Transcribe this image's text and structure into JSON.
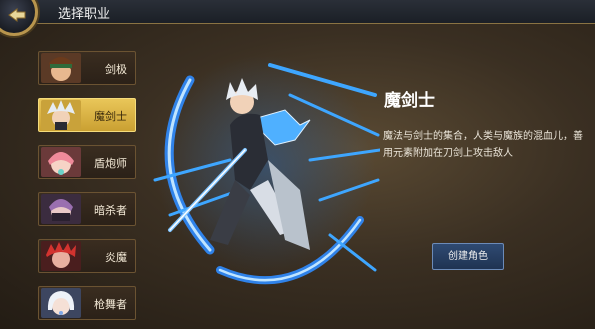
{
  "header": {
    "title": "选择职业"
  },
  "classes": [
    {
      "label": "剑极"
    },
    {
      "label": "魔剑士"
    },
    {
      "label": "盾炮师"
    },
    {
      "label": "暗杀者"
    },
    {
      "label": "炎魔"
    },
    {
      "label": "枪舞者"
    }
  ],
  "selected_index": 1,
  "detail": {
    "name": "魔剑士",
    "description": "魔法与剑士的集合，人类与魔族的混血儿，善用元素附加在刀剑上攻击敌人"
  },
  "create_button": {
    "label": "创建角色"
  },
  "colors": {
    "accent_gold": "#e9c659",
    "panel_brown": "#3a2d20",
    "button_blue": "#2f4a72",
    "energy_blue": "#3ea6ff"
  }
}
